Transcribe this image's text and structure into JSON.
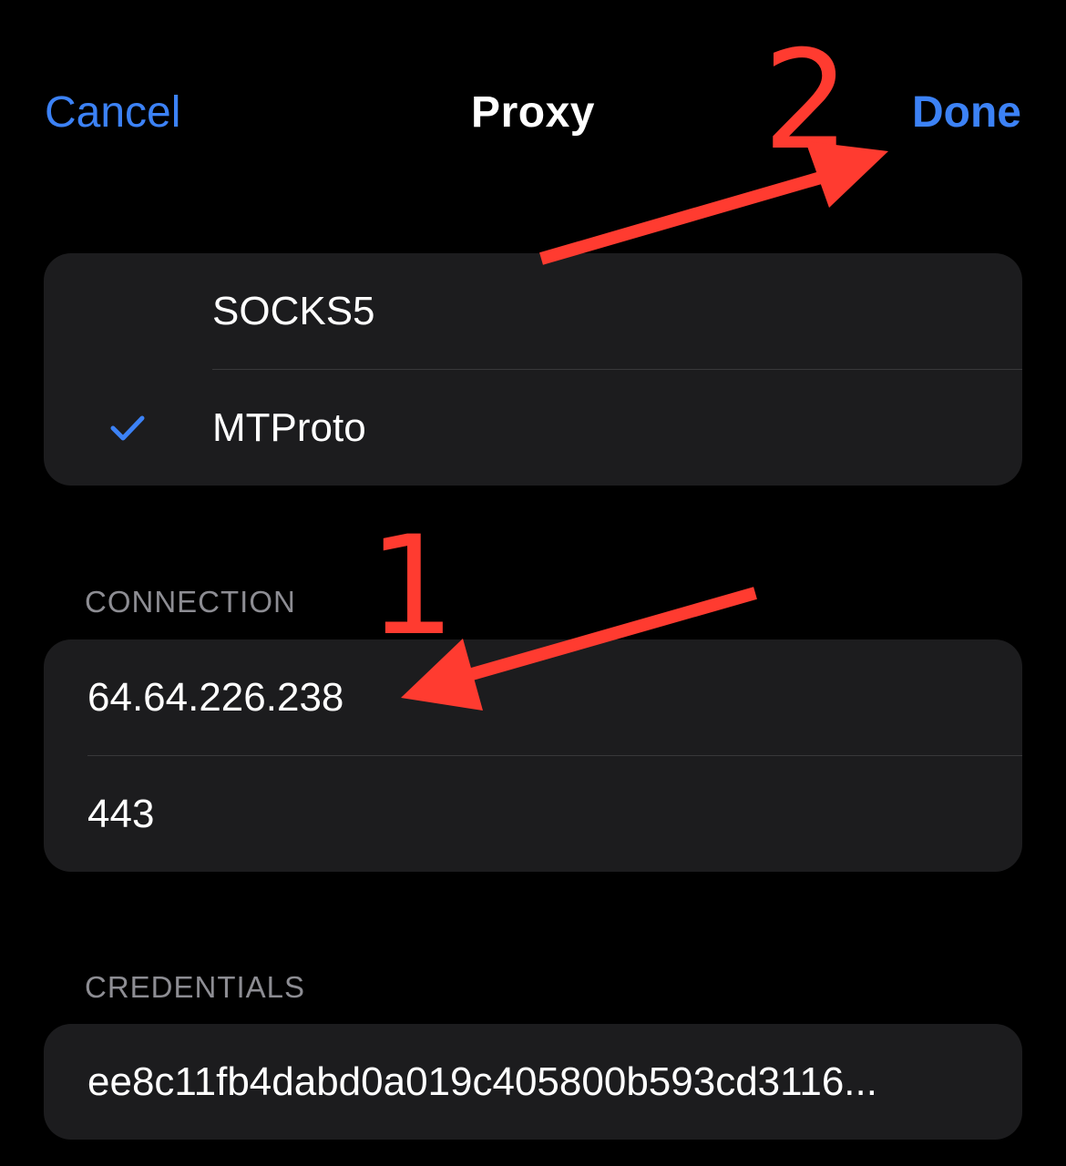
{
  "nav": {
    "cancel_label": "Cancel",
    "title": "Proxy",
    "done_label": "Done"
  },
  "proxy_types": {
    "items": [
      {
        "label": "SOCKS5",
        "selected": false
      },
      {
        "label": "MTProto",
        "selected": true
      }
    ]
  },
  "connection": {
    "header": "CONNECTION",
    "server": "64.64.226.238",
    "port": "443"
  },
  "credentials": {
    "header": "CREDENTIALS",
    "secret": "ee8c11fb4dabd0a019c405800b593cd3116..."
  },
  "annotations": {
    "marker_1": "1",
    "marker_2": "2",
    "color": "#ff3b30"
  },
  "colors": {
    "accent": "#3c82f6",
    "background": "#000000",
    "group_background": "#1c1c1e",
    "secondary_text": "#8d8d93"
  }
}
